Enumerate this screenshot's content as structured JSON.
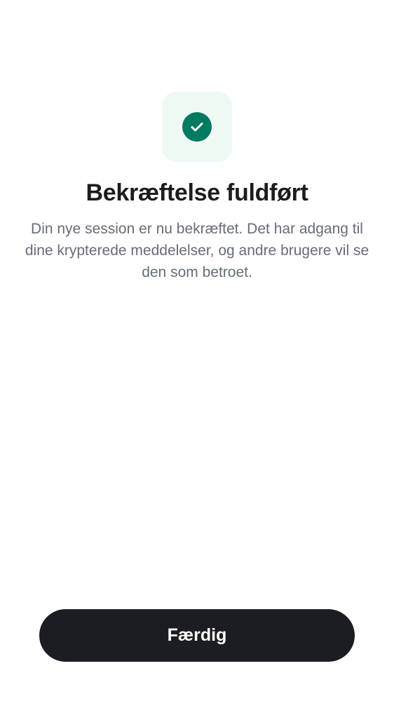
{
  "title": "Bekræftelse fuldført",
  "description": "Din nye session er nu bekræftet. Det har adgang til dine krypterede meddelelser, og andre brugere vil se den som betroet.",
  "done_button": "Færdig",
  "icon": "check-circle-icon",
  "colors": {
    "accent": "#007a61",
    "icon_bg": "#eff9f3",
    "button": "#1b1d22"
  }
}
